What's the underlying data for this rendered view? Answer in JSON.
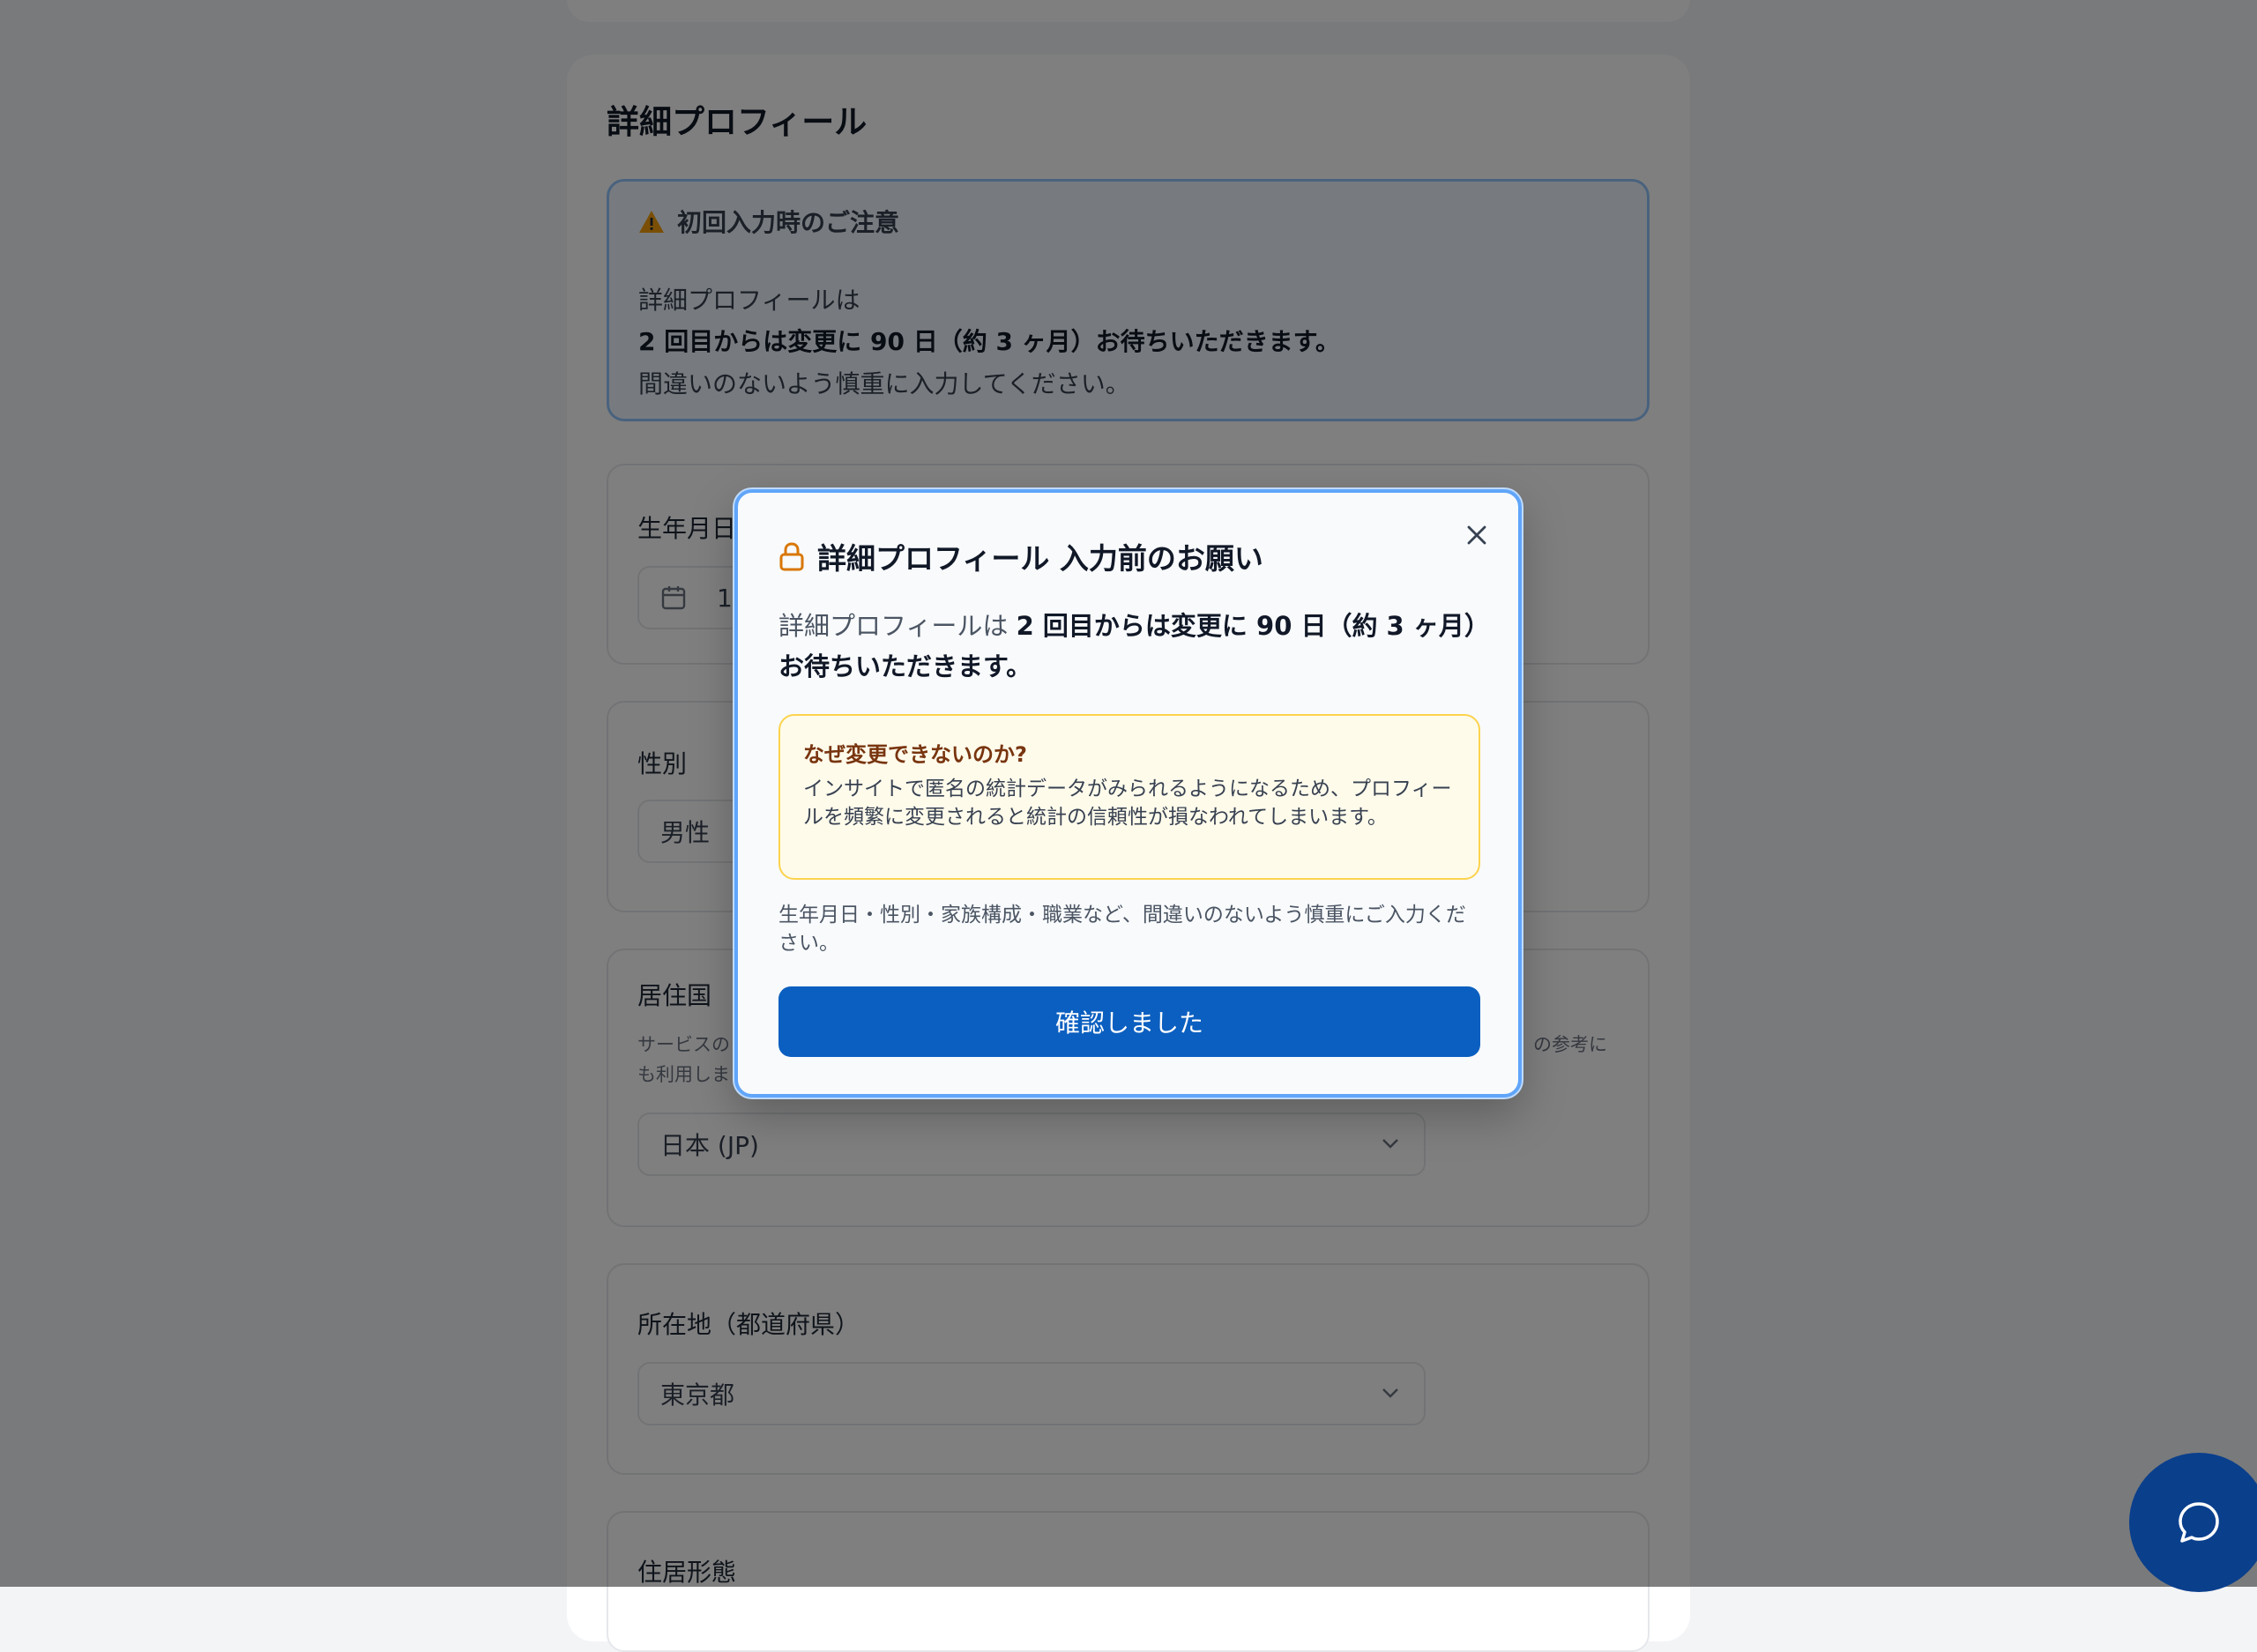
{
  "profile": {
    "title": "詳細プロフィール",
    "notice": {
      "title": "初回入力時のご注意",
      "line1": "詳細プロフィールは",
      "line2": "2 回目からは変更に 90 日（約 3 ヶ月）お待ちいただきます。",
      "line3": "間違いのないよう慎重に入力してください。"
    },
    "fields": {
      "birthdate": {
        "label": "生年月日",
        "value": "1"
      },
      "gender": {
        "label": "性別",
        "value": "男性"
      },
      "country": {
        "label": "居住国",
        "help_left": "サービスの",
        "help_right": "の参考に",
        "help_line2": "も利用しま",
        "value": "日本 (JP)"
      },
      "prefecture": {
        "label": "所在地（都道府県）",
        "value": "東京都"
      },
      "housing": {
        "label": "住居形態"
      }
    }
  },
  "modal": {
    "title": "詳細プロフィール 入力前のお願い",
    "desc_plain": "詳細プロフィールは ",
    "desc_strong": "2 回目からは変更に 90 日（約 3 ヶ月）お待ちいただきます。",
    "why_title": "なぜ変更できないのか?",
    "why_body": "インサイトで匿名の統計データがみられるようになるため、プロフィールを頻繁に変更されると統計の信頼性が損なわれてしまいます。",
    "note": "生年月日・性別・家族構成・職業など、間違いのないよう慎重にご入力ください。",
    "confirm_label": "確認しました"
  },
  "colors": {
    "primary": "#0b5fc0",
    "modal_border": "#60a5fa",
    "warning_bg": "#fffbeb",
    "warning_border": "#fcd34d",
    "warning_title": "#78350f",
    "lock_icon": "#d97706",
    "chat_fab": "#0a3f8c"
  },
  "icons": {
    "warning": "warning-triangle-icon",
    "lock": "lock-icon",
    "close": "close-icon",
    "calendar": "calendar-icon",
    "chevron": "chevron-down-icon",
    "chat": "chat-bubble-icon"
  }
}
